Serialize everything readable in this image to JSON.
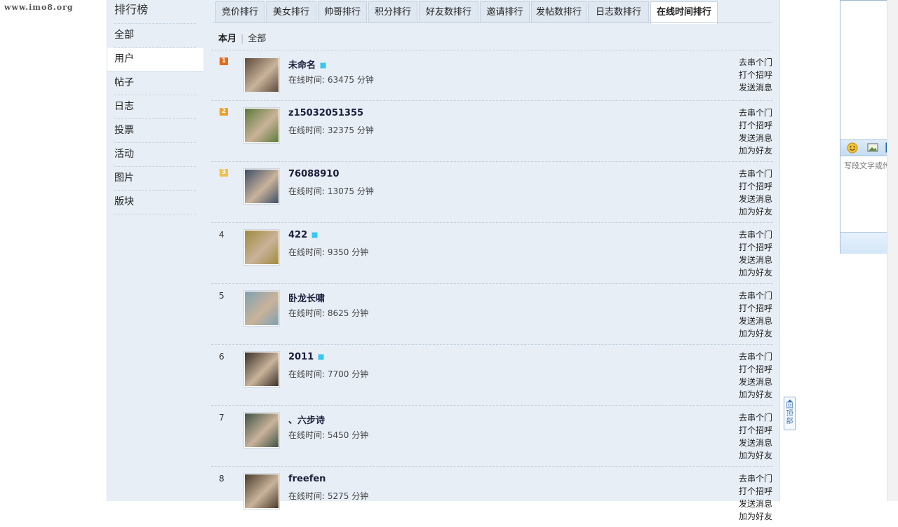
{
  "watermark": "www.imo8.org",
  "sidebar": {
    "title": "排行榜",
    "items": [
      {
        "label": "全部",
        "name": "all"
      },
      {
        "label": "用户",
        "name": "users"
      },
      {
        "label": "帖子",
        "name": "posts"
      },
      {
        "label": "日志",
        "name": "blogs"
      },
      {
        "label": "投票",
        "name": "polls"
      },
      {
        "label": "活动",
        "name": "events"
      },
      {
        "label": "图片",
        "name": "pictures"
      },
      {
        "label": "版块",
        "name": "forums"
      }
    ],
    "active": "users"
  },
  "tabs": [
    {
      "label": "竞价排行"
    },
    {
      "label": "美女排行"
    },
    {
      "label": "帅哥排行"
    },
    {
      "label": "积分排行"
    },
    {
      "label": "好友数排行"
    },
    {
      "label": "邀请排行"
    },
    {
      "label": "发帖数排行"
    },
    {
      "label": "日志数排行"
    },
    {
      "label": "在线时间排行"
    }
  ],
  "active_tab": "在线时间排行",
  "period": {
    "current": "本月",
    "other": "全部"
  },
  "online_time_prefix": "在线时间: ",
  "online_time_suffix": " 分钟",
  "actions": {
    "visit": "去串个门",
    "greet": "打个招呼",
    "message": "发送消息",
    "add_friend": "加为好友"
  },
  "rankings": [
    {
      "rank": "1",
      "name": "未命名",
      "online": true,
      "minutes": "63475",
      "avatar_color": "#5d4a3e",
      "actions": [
        "visit",
        "greet",
        "message"
      ]
    },
    {
      "rank": "2",
      "name": "z15032051355",
      "online": false,
      "minutes": "32375",
      "avatar_color": "#5c7a3a",
      "actions": [
        "visit",
        "greet",
        "message",
        "add_friend"
      ]
    },
    {
      "rank": "3",
      "name": "76088910",
      "online": false,
      "minutes": "13075",
      "avatar_color": "#3d4e68",
      "actions": [
        "visit",
        "greet",
        "message",
        "add_friend"
      ]
    },
    {
      "rank": "4",
      "name": "422",
      "online": true,
      "minutes": "9350",
      "avatar_color": "#a08a3c",
      "actions": [
        "visit",
        "greet",
        "message",
        "add_friend"
      ]
    },
    {
      "rank": "5",
      "name": "卧龙长啸",
      "online": false,
      "minutes": "8625",
      "avatar_color": "#7fa0b3",
      "actions": [
        "visit",
        "greet",
        "message",
        "add_friend"
      ]
    },
    {
      "rank": "6",
      "name": "2011",
      "online": true,
      "minutes": "7700",
      "avatar_color": "#3a2f2a",
      "actions": [
        "visit",
        "greet",
        "message",
        "add_friend"
      ]
    },
    {
      "rank": "7",
      "name": "、六步诗",
      "online": false,
      "minutes": "5450",
      "avatar_color": "#3f5246",
      "actions": [
        "visit",
        "greet",
        "message",
        "add_friend"
      ]
    },
    {
      "rank": "8",
      "name": "freefen",
      "online": false,
      "minutes": "5275",
      "avatar_color": "#4a3b2c",
      "actions": [
        "visit",
        "greet",
        "message",
        "add_friend"
      ]
    }
  ],
  "badge_colors": [
    "#e06b1a",
    "#eaa02a",
    "#f0bf4c"
  ],
  "back_to_top": "回顶部",
  "chat": {
    "tools": [
      {
        "name": "emoji-icon"
      },
      {
        "name": "image-icon"
      },
      {
        "name": "screenshot-icon"
      }
    ],
    "placeholder": "写段文字或传张图片到这个空间中，随心记录"
  }
}
